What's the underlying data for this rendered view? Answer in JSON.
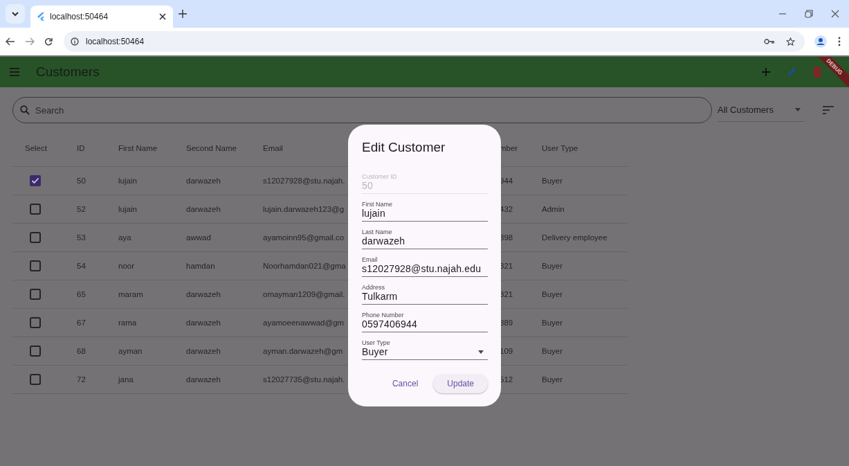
{
  "browser": {
    "tab_title": "localhost:50464",
    "url": "localhost:50464"
  },
  "app_bar": {
    "title": "Customers",
    "debug_banner": "DEBUG"
  },
  "search": {
    "placeholder": "Search"
  },
  "filter": {
    "value": "All Customers"
  },
  "table": {
    "columns": [
      "Select",
      "ID",
      "First Name",
      "Second Name",
      "Email",
      "mber",
      "User Type"
    ],
    "rows": [
      {
        "checked": true,
        "id": "50",
        "first_name": "lujain",
        "second_name": "darwazeh",
        "email": "s12027928@stu.najah.",
        "column_6": "944",
        "user_type": "Buyer"
      },
      {
        "checked": false,
        "id": "52",
        "first_name": "lujain",
        "second_name": "darwazeh",
        "email": "lujain.darwazeh123@g",
        "column_6": "432",
        "user_type": "Admin"
      },
      {
        "checked": false,
        "id": "53",
        "first_name": "aya",
        "second_name": "awwad",
        "email": "ayamoinn95@gmail.co",
        "column_6": "398",
        "user_type": "Delivery employee"
      },
      {
        "checked": false,
        "id": "54",
        "first_name": "noor",
        "second_name": "hamdan",
        "email": "Noorhamdan021@gma",
        "column_6": "321",
        "user_type": "Buyer"
      },
      {
        "checked": false,
        "id": "65",
        "first_name": "maram",
        "second_name": "darwazeh",
        "email": "omayman1209@gmail.",
        "column_6": "321",
        "user_type": "Buyer"
      },
      {
        "checked": false,
        "id": "67",
        "first_name": "rama",
        "second_name": "darwazeh",
        "email": "ayamoeenawwad@gm",
        "column_6": "389",
        "user_type": "Buyer"
      },
      {
        "checked": false,
        "id": "68",
        "first_name": "ayman",
        "second_name": "darwazeh",
        "email": "ayman.darwazeh@gm",
        "column_6": "109",
        "user_type": "Buyer"
      },
      {
        "checked": false,
        "id": "72",
        "first_name": "jana",
        "second_name": "darwazeh",
        "email": "s12027735@stu.najah.",
        "column_6": "512",
        "user_type": "Buyer"
      }
    ]
  },
  "dialog": {
    "title": "Edit Customer",
    "fields": [
      {
        "kind": "text",
        "label": "Customer ID",
        "value": "50",
        "disabled": true
      },
      {
        "kind": "text",
        "label": "First Name",
        "value": "lujain",
        "disabled": false
      },
      {
        "kind": "text",
        "label": "Last Name",
        "value": "darwazeh",
        "disabled": false
      },
      {
        "kind": "text",
        "label": "Email",
        "value": "s12027928@stu.najah.edu",
        "disabled": false
      },
      {
        "kind": "text",
        "label": "Address",
        "value": "Tulkarm",
        "disabled": false
      },
      {
        "kind": "text",
        "label": "Phone Number",
        "value": "0597406944",
        "disabled": false
      },
      {
        "kind": "dropdown",
        "label": "User Type",
        "value": "Buyer",
        "disabled": false
      }
    ],
    "buttons": [
      {
        "kind": "text",
        "label": "Cancel"
      },
      {
        "kind": "tonal",
        "label": "Update"
      }
    ]
  }
}
